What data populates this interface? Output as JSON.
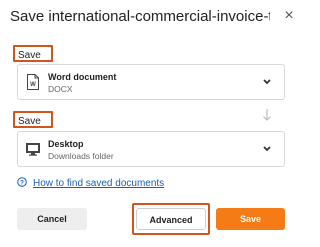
{
  "dialog": {
    "title": "Save international-commercial-invoice-tem...",
    "close_symbol": "×"
  },
  "save_as": {
    "label": "Save as",
    "format_name": "Word document",
    "format_ext": "DOCX",
    "icon": "word-document-icon"
  },
  "save_to": {
    "label": "Save to",
    "location_name": "Desktop",
    "location_detail": "Downloads folder",
    "icon": "monitor-icon"
  },
  "help": {
    "link_text": "How to find saved documents",
    "icon": "question-circle-icon"
  },
  "buttons": {
    "cancel": "Cancel",
    "advanced": "Advanced",
    "save": "Save"
  },
  "colors": {
    "accent": "#f47b16",
    "highlight": "#d0561e",
    "link": "#1a5fb4"
  }
}
